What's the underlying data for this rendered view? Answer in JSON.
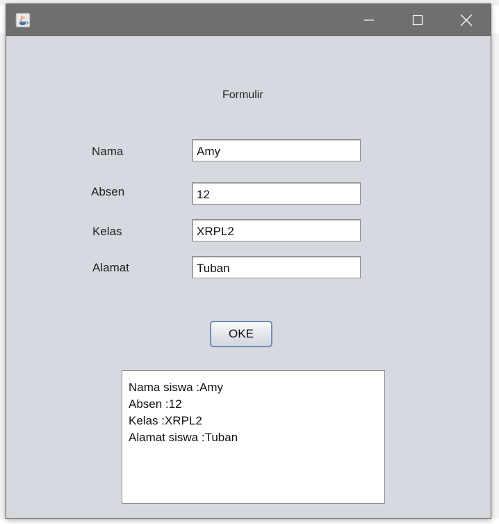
{
  "window": {
    "app_icon": "java-cup-icon",
    "controls": [
      "minimize-icon",
      "maximize-icon",
      "close-icon"
    ]
  },
  "form": {
    "title": "Formulir",
    "fields": [
      {
        "label": "Nama",
        "value": "Amy"
      },
      {
        "label": "Absen",
        "value": "12"
      },
      {
        "label": "Kelas",
        "value": "XRPL2"
      },
      {
        "label": "Alamat",
        "value": "Tuban"
      }
    ],
    "button_label": "OKE"
  },
  "output": {
    "lines": [
      "Nama siswa :Amy",
      "Absen :12",
      "Kelas :XRPL2",
      "Alamat siswa :Tuban"
    ]
  },
  "colors": {
    "titlebar": "#6f6f6f",
    "window_bg": "#d6d9df",
    "button_border": "#6d8fb5"
  }
}
